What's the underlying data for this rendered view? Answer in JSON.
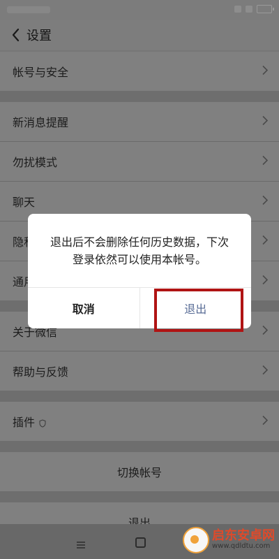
{
  "header": {
    "title": "设置"
  },
  "groups": [
    {
      "items": [
        {
          "label": "帐号与安全"
        }
      ]
    },
    {
      "items": [
        {
          "label": "新消息提醒"
        },
        {
          "label": "勿扰模式"
        },
        {
          "label": "聊天"
        },
        {
          "label": "隐私"
        },
        {
          "label": "通用"
        }
      ]
    },
    {
      "items": [
        {
          "label": "关于微信"
        },
        {
          "label": "帮助与反馈"
        }
      ]
    },
    {
      "items": [
        {
          "label": "插件"
        }
      ]
    }
  ],
  "actions": {
    "switch_account": "切换帐号",
    "logout": "退出"
  },
  "dialog": {
    "message": "退出后不会删除任何历史数据，下次登录依然可以使用本帐号。",
    "cancel": "取消",
    "confirm": "退出"
  },
  "watermark": {
    "title": "启东安卓网",
    "url": "www.qdldtu.com"
  },
  "colors": {
    "dim_background": "#767676",
    "dialog_bg": "#ffffff",
    "confirm_text": "#576b95",
    "highlight_border": "#b01414"
  }
}
